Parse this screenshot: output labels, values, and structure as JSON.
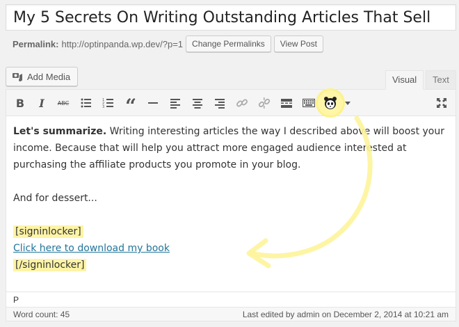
{
  "post": {
    "title": "My 5 Secrets On Writing Outstanding Articles That Sell"
  },
  "permalink": {
    "label": "Permalink:",
    "url": "http://optinpanda.wp.dev/?p=1",
    "change_button": "Change Permalinks",
    "view_button": "View Post"
  },
  "media": {
    "add_label": "Add Media",
    "icon": "camera-music-icon"
  },
  "tabs": [
    {
      "label": "Visual",
      "active": true
    },
    {
      "label": "Text",
      "active": false
    }
  ],
  "toolbar": {
    "buttons": [
      {
        "name": "bold",
        "glyph": "B"
      },
      {
        "name": "italic",
        "glyph": "I"
      },
      {
        "name": "strikethrough",
        "glyph": "ABC"
      },
      {
        "name": "bulleted-list"
      },
      {
        "name": "numbered-list"
      },
      {
        "name": "blockquote",
        "glyph": "“"
      },
      {
        "name": "horizontal-line"
      },
      {
        "name": "align-left"
      },
      {
        "name": "align-center"
      },
      {
        "name": "align-right"
      },
      {
        "name": "insert-link"
      },
      {
        "name": "remove-link"
      },
      {
        "name": "read-more"
      },
      {
        "name": "toolbar-toggle"
      },
      {
        "name": "optin-panda"
      },
      {
        "name": "locker-dropdown"
      },
      {
        "name": "fullscreen"
      }
    ],
    "highlight_color": "#fdf28b"
  },
  "content": {
    "summary_bold": "Let's summarize.",
    "summary_text": " Writing interesting articles the way I described above will boost your income. Because that will help you attract more engaged audience interested at purchasing the affiliate products you promote in your blog.",
    "dessert": "And for dessert...",
    "locker_open": "[signinlocker]",
    "link_text": "Click here to download my book",
    "locker_close": "[/signinlocker]"
  },
  "status": {
    "path": "P",
    "word_count": "Word count: 45",
    "last_edited": "Last edited by admin on December 2, 2014 at 10:21 am"
  },
  "colors": {
    "highlight": "#fdf4a6",
    "arrow": "#fdf49a",
    "link": "#21759b"
  }
}
